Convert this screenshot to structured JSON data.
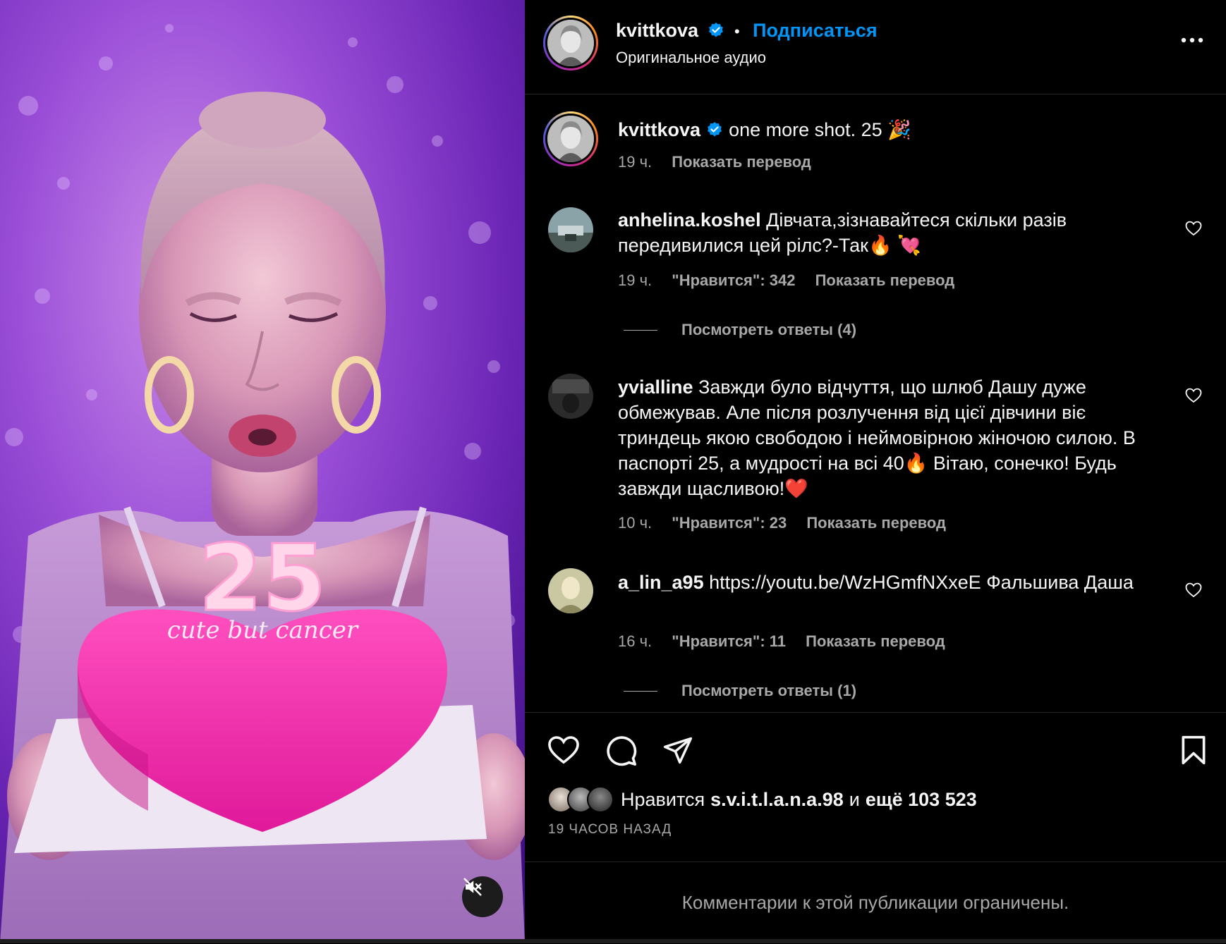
{
  "media": {
    "cake_candle_text": "25",
    "cake_writing": "cute but cancer",
    "mute_icon": "speaker-muted-icon"
  },
  "header": {
    "username": "kvittkova",
    "dot": "•",
    "follow_label": "Подписаться",
    "audio_label": "Оригинальное аудио",
    "more_icon": "more-horizontal-icon"
  },
  "caption": {
    "username": "kvittkova",
    "text": "one more shot. 25 🎉",
    "time": "19 ч.",
    "translate": "Показать перевод"
  },
  "comments": [
    {
      "username": "anhelina.koshel",
      "text": "Дівчата,зізнавайтеся скільки разів передивилися цей рілс?-Так🔥 💘",
      "time": "19 ч.",
      "likes": "\"Нравится\": 342",
      "translate": "Показать перевод",
      "replies": "Посмотреть ответы (4)"
    },
    {
      "username": "yvialline",
      "text": "Завжди було відчуття, що шлюб Дашу дуже обмежував. Але після розлучення від цієї дівчини віє триндець якою свободою і неймовірною жіночою силою. В паспорті 25, а мудрості на всі 40🔥 Вітаю, сонечко! Будь завжди щасливою!❤️",
      "time": "10 ч.",
      "likes": "\"Нравится\": 23",
      "translate": "Показать перевод"
    },
    {
      "username": "a_lin_a95",
      "text": "https://youtu.be/WzHGmfNXxeE Фальшива Даша",
      "time": "16 ч.",
      "likes": "\"Нравится\": 11",
      "translate": "Показать перевод",
      "replies": "Посмотреть ответы (1)"
    }
  ],
  "footer": {
    "likes_prefix": "Нравится",
    "liked_by": "s.v.i.t.l.a.n.a.98",
    "and_word": "и",
    "others": "ещё 103 523",
    "time_ago": "19 ЧАСОВ НАЗАД",
    "restricted": "Комментарии к этой публикации ограничены."
  },
  "colors": {
    "accent_blue": "#0095f6",
    "secondary_text": "#a8a8a8",
    "divider": "#262626",
    "background": "#000000"
  }
}
